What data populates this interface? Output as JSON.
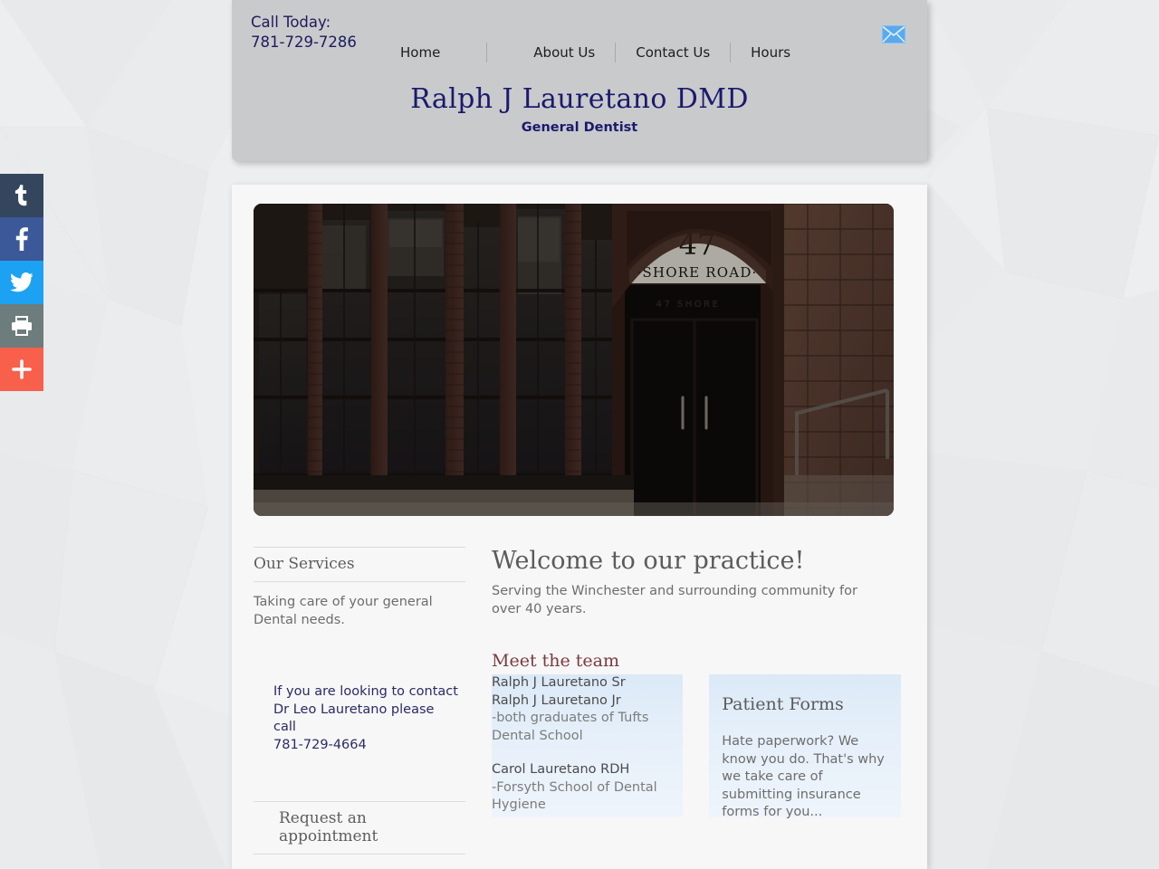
{
  "background": {
    "page_color": "#edeeef",
    "header_panel_color": "#c9cacb",
    "content_panel_color": "#f7f7f7"
  },
  "social_rail": {
    "items": [
      {
        "name": "tumblr",
        "label": "t",
        "color": "#34465d"
      },
      {
        "name": "facebook",
        "label": "f",
        "color": "#3b5998"
      },
      {
        "name": "twitter",
        "label": "twitter-bird",
        "color": "#1da1f2"
      },
      {
        "name": "print",
        "label": "printer",
        "color": "#6d7c7c"
      },
      {
        "name": "more",
        "label": "+",
        "color": "#f8604c"
      }
    ]
  },
  "header": {
    "call_label": "Call Today:",
    "phone": "781-729-7286",
    "mail_icon": "envelope-icon",
    "mail_icon_color": "#5aa9f0",
    "nav": [
      {
        "label": "Home"
      },
      {
        "label": "About Us"
      },
      {
        "label": "Contact Us"
      },
      {
        "label": "Hours"
      }
    ],
    "title": "Ralph J Lauretano DMD",
    "subtitle": "General Dentist",
    "title_color": "#1a1a6e"
  },
  "hero": {
    "alt": "brick dental office building exterior",
    "sign_number": "47",
    "sign_street": "SHORE ROAD",
    "secondary_sign": "47 SHORE"
  },
  "left_column": {
    "services_heading": "Our Services",
    "services_body": "Taking care of your general Dental needs.",
    "contact_note_lines": [
      "If you are looking to contact",
      "Dr Leo Lauretano please",
      "call",
      "781-729-4664"
    ],
    "request_heading": "Request an appointment"
  },
  "right_column": {
    "welcome_title": "Welcome to our practice!",
    "welcome_body": "Serving the Winchester and surrounding community for over 40 years.",
    "meet_heading": "Meet the team",
    "meet_heading_color": "#7b3a3f",
    "team": [
      {
        "name": "Ralph J Lauretano Sr",
        "school": ""
      },
      {
        "name": "Ralph J Lauretano Jr",
        "school": "  -both graduates of Tufts Dental School"
      },
      {
        "name": "Carol Lauretano RDH",
        "school": "   -Forsyth School of Dental Hygiene"
      }
    ],
    "patient_forms": {
      "title": "Patient Forms",
      "body": "Hate paperwork? We know you do. That's why we take care of submitting insurance forms for you..."
    }
  }
}
